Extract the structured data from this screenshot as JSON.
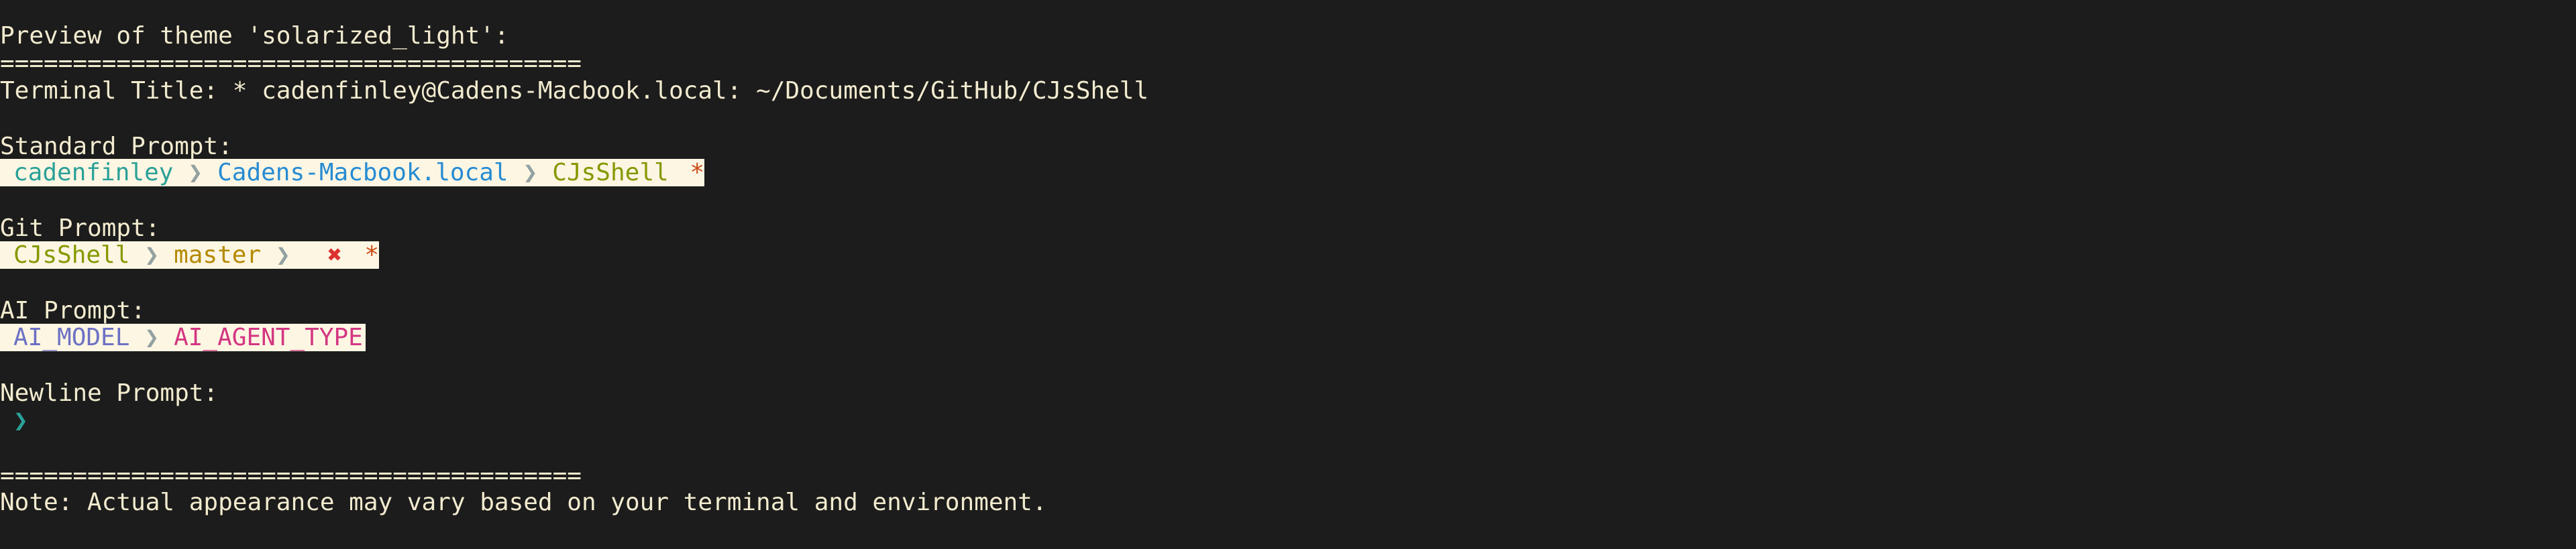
{
  "header": "Preview of theme 'solarized_light':",
  "divider": "========================================",
  "terminal_title": "Terminal Title: * cadenfinley@Cadens-Macbook.local: ~/Documents/GitHub/CJsShell",
  "standard": {
    "label": "Standard Prompt:",
    "user": "cadenfinley",
    "host": "Cadens-Macbook.local",
    "dir": "CJsShell",
    "status": "*",
    "separator": "❯"
  },
  "git": {
    "label": "Git Prompt:",
    "repo": "CJsShell",
    "branch": "master",
    "dirty": "✖",
    "status": "*",
    "separator": "❯"
  },
  "ai": {
    "label": "AI Prompt:",
    "model": "AI_MODEL",
    "agent": "AI_AGENT_TYPE",
    "separator": "❯"
  },
  "newline": {
    "label": "Newline Prompt:",
    "symbol": "❯"
  },
  "note": "Note: Actual appearance may vary based on your terminal and environment.",
  "colors": {
    "background": "#1c1c1c",
    "foreground": "#f2ebcf",
    "prompt_bg": "#fdf6e3",
    "cyan": "#2aa198",
    "blue": "#268bd2",
    "yellow": "#859900",
    "orange": "#cb4b16",
    "gold": "#b58900",
    "red": "#dc322f",
    "violet": "#6c71c4",
    "magenta": "#d33682",
    "separator": "#93a1a1"
  }
}
